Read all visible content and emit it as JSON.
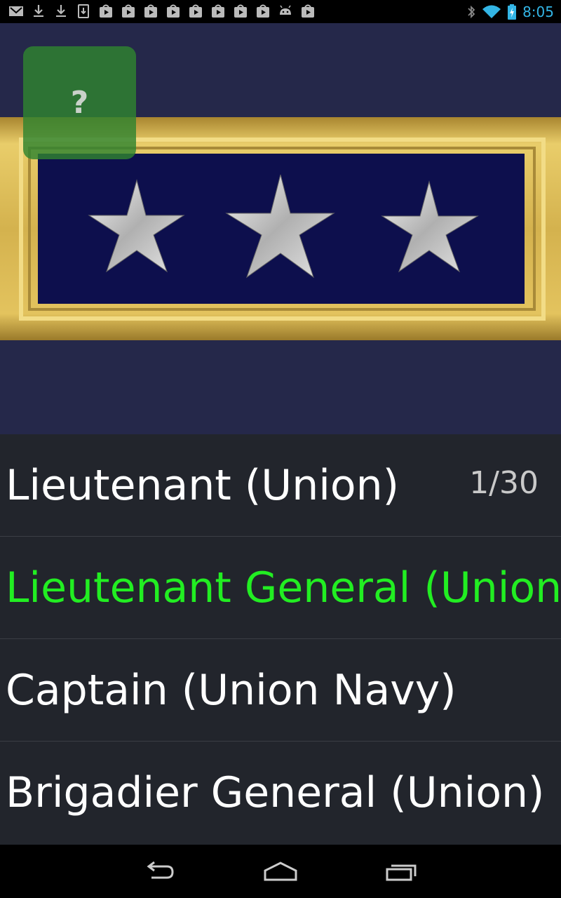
{
  "status_bar": {
    "time": "8:05",
    "notification_icons": [
      "gmail-icon",
      "download-icon",
      "download-icon",
      "download-icon",
      "play-store-icon",
      "play-store-icon",
      "play-store-icon",
      "play-store-icon",
      "play-store-icon",
      "play-store-icon",
      "play-store-icon",
      "play-store-icon",
      "android-icon",
      "play-store-icon"
    ],
    "system_icons": [
      "bluetooth-icon",
      "wifi-icon",
      "battery-charging-icon"
    ]
  },
  "quiz": {
    "image": "three-star-shoulder-strap",
    "hint_label": "?",
    "progress": "1/30",
    "answers": [
      {
        "label": "Lieutenant (Union)",
        "state": "normal"
      },
      {
        "label": "Lieutenant General (Union)",
        "state": "correct"
      },
      {
        "label": "Captain (Union Navy)",
        "state": "normal"
      },
      {
        "label": "Brigadier General (Union)",
        "state": "normal"
      }
    ]
  },
  "colors": {
    "background": "#25284a",
    "correct": "#22ee22",
    "list_bg": "#22252c",
    "status_accent": "#33b5e5"
  },
  "nav_bar": {
    "buttons": [
      "back-icon",
      "home-icon",
      "recent-apps-icon"
    ]
  }
}
